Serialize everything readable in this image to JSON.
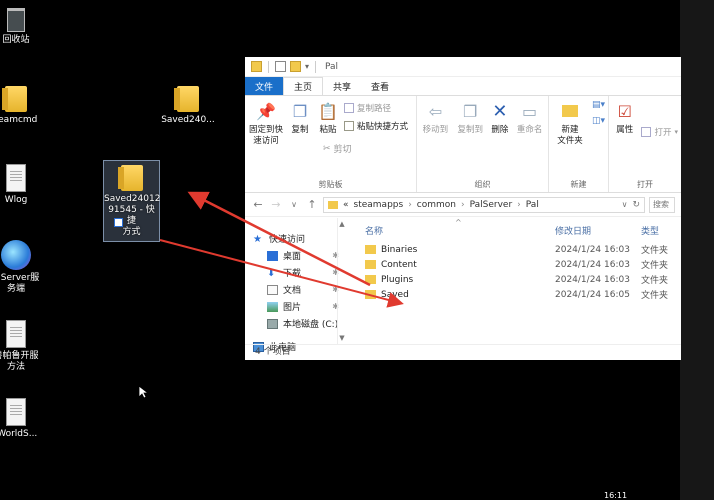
{
  "desktop": {
    "icons": [
      {
        "label": "回收站"
      },
      {
        "label": "teamcmd"
      },
      {
        "label": "Wlog"
      },
      {
        "label": "alServer服\n务端"
      },
      {
        "label": "兽帕鲁开服\n方法"
      },
      {
        "label": "lWorldS..."
      },
      {
        "label": "Saved240..."
      },
      {
        "label": "Saved24012\n91545 - 快捷\n方式"
      }
    ],
    "clock": "16:11"
  },
  "explorer": {
    "title": "Pal",
    "tabs": [
      "文件",
      "主页",
      "共享",
      "查看"
    ],
    "ribbon": {
      "pin_label": "固定到快\n速访问",
      "copy_label": "复制",
      "paste_label": "粘贴",
      "copy_path_label": "复制路径",
      "paste_shortcut_label": "粘贴快捷方式",
      "cut_label": "剪切",
      "clipboard_group": "剪贴板",
      "move_to_label": "移动到",
      "copy_to_label": "复制到",
      "delete_label": "删除",
      "rename_label": "重命名",
      "organize_group": "组织",
      "new_folder_label": "新建\n文件夹",
      "new_group": "新建",
      "properties_label": "属性",
      "open_label": "打开",
      "open_group": "打开"
    },
    "address": {
      "prefix": "«",
      "segments": [
        "steamapps",
        "common",
        "PalServer",
        "Pal"
      ],
      "search_placeholder": "搜索"
    },
    "nav": [
      {
        "label": "快速访问"
      },
      {
        "label": "桌面"
      },
      {
        "label": "下载"
      },
      {
        "label": "文档"
      },
      {
        "label": "图片"
      },
      {
        "label": "本地磁盘 (C:)"
      },
      {
        "label": "此电脑"
      }
    ],
    "columns": {
      "name": "名称",
      "date": "修改日期",
      "type": "类型"
    },
    "files": [
      {
        "name": "Binaries",
        "date": "2024/1/24 16:03",
        "type": "文件夹"
      },
      {
        "name": "Content",
        "date": "2024/1/24 16:03",
        "type": "文件夹"
      },
      {
        "name": "Plugins",
        "date": "2024/1/24 16:03",
        "type": "文件夹"
      },
      {
        "name": "Saved",
        "date": "2024/1/24 16:05",
        "type": "文件夹"
      }
    ],
    "status": "4 个项目"
  },
  "colors": {
    "accent": "#1a6fc9",
    "arrow": "#e03a2f",
    "folder": "#f2c94c"
  }
}
